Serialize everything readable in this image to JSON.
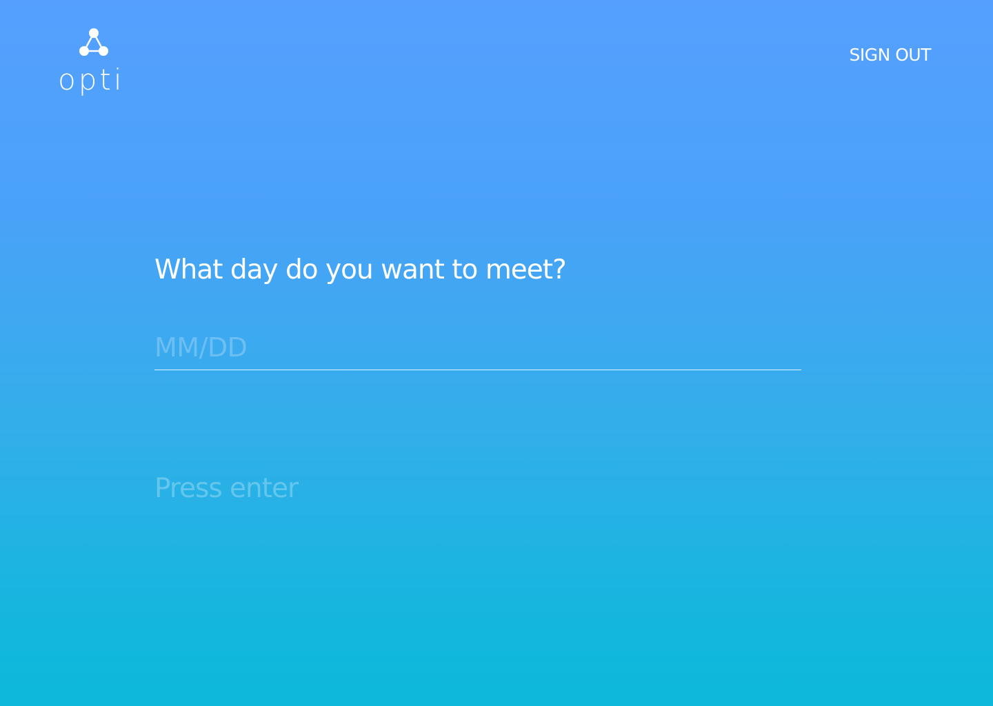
{
  "brand": {
    "name": "opti",
    "icon": "network-triangle-icon"
  },
  "header": {
    "sign_out_label": "SIGN OUT"
  },
  "form": {
    "question": "What day do you want to meet?",
    "date_value": "",
    "date_placeholder": "MM/DD",
    "hint": "Press enter"
  },
  "colors": {
    "gradient_top": "#55a0fe",
    "gradient_bottom": "#0db8da",
    "text": "#ffffff"
  }
}
